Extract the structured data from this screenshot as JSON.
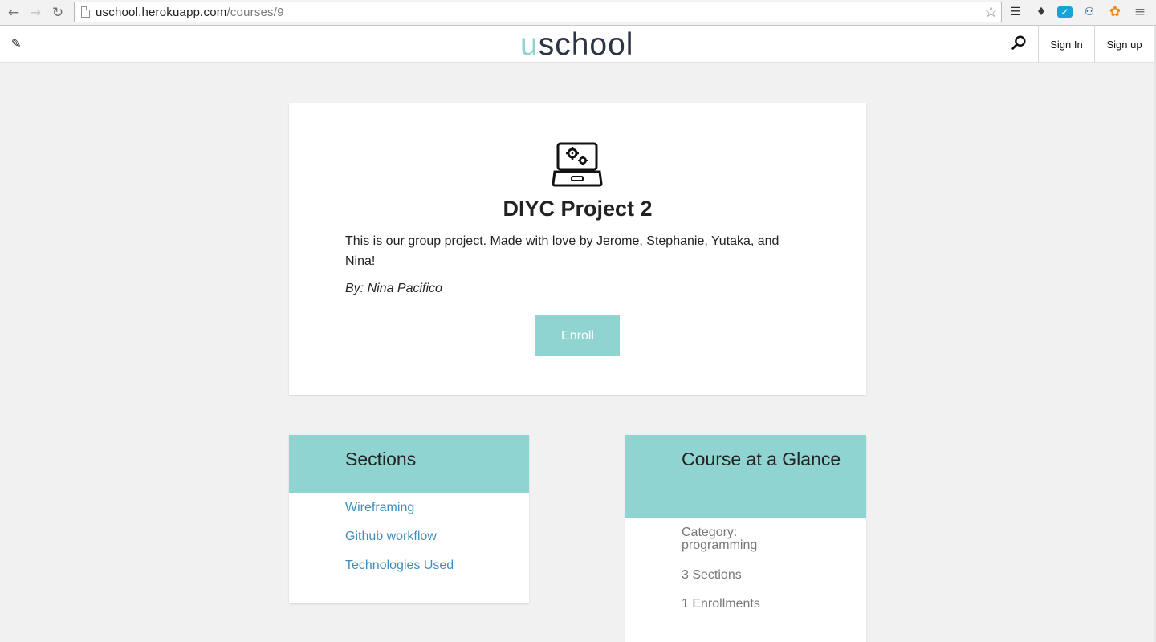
{
  "browser": {
    "url_host": "uschool.herokuapp.com",
    "url_path": "/courses/9"
  },
  "header": {
    "logo_u": "u",
    "logo_rest": "school",
    "sign_in": "Sign In",
    "sign_up": "Sign up"
  },
  "course": {
    "title": "DIYC Project 2",
    "description": "This is our group project. Made with love by Jerome, Stephanie, Yutaka, and Nina!",
    "author": "By: Nina Pacifico",
    "enroll_label": "Enroll"
  },
  "sections": {
    "heading": "Sections",
    "items": [
      "Wireframing",
      "Github workflow",
      "Technologies Used"
    ]
  },
  "glance": {
    "heading": "Course at a Glance",
    "category": "Category: programming",
    "sections_count": "3 Sections",
    "enrollments": "1 Enrollments"
  },
  "colors": {
    "accent": "#8fd4d0",
    "link": "#3d8ebc",
    "page_bg": "#f1f1f1",
    "logo_dark": "#2b3544"
  },
  "icons": {
    "back": "arrow-left-icon",
    "forward": "arrow-right-icon",
    "reload": "reload-icon",
    "bookmark": "star-icon",
    "edit": "pencil-icon",
    "search": "search-icon",
    "course": "laptop-gears-icon",
    "menu": "hamburger-menu-icon"
  }
}
